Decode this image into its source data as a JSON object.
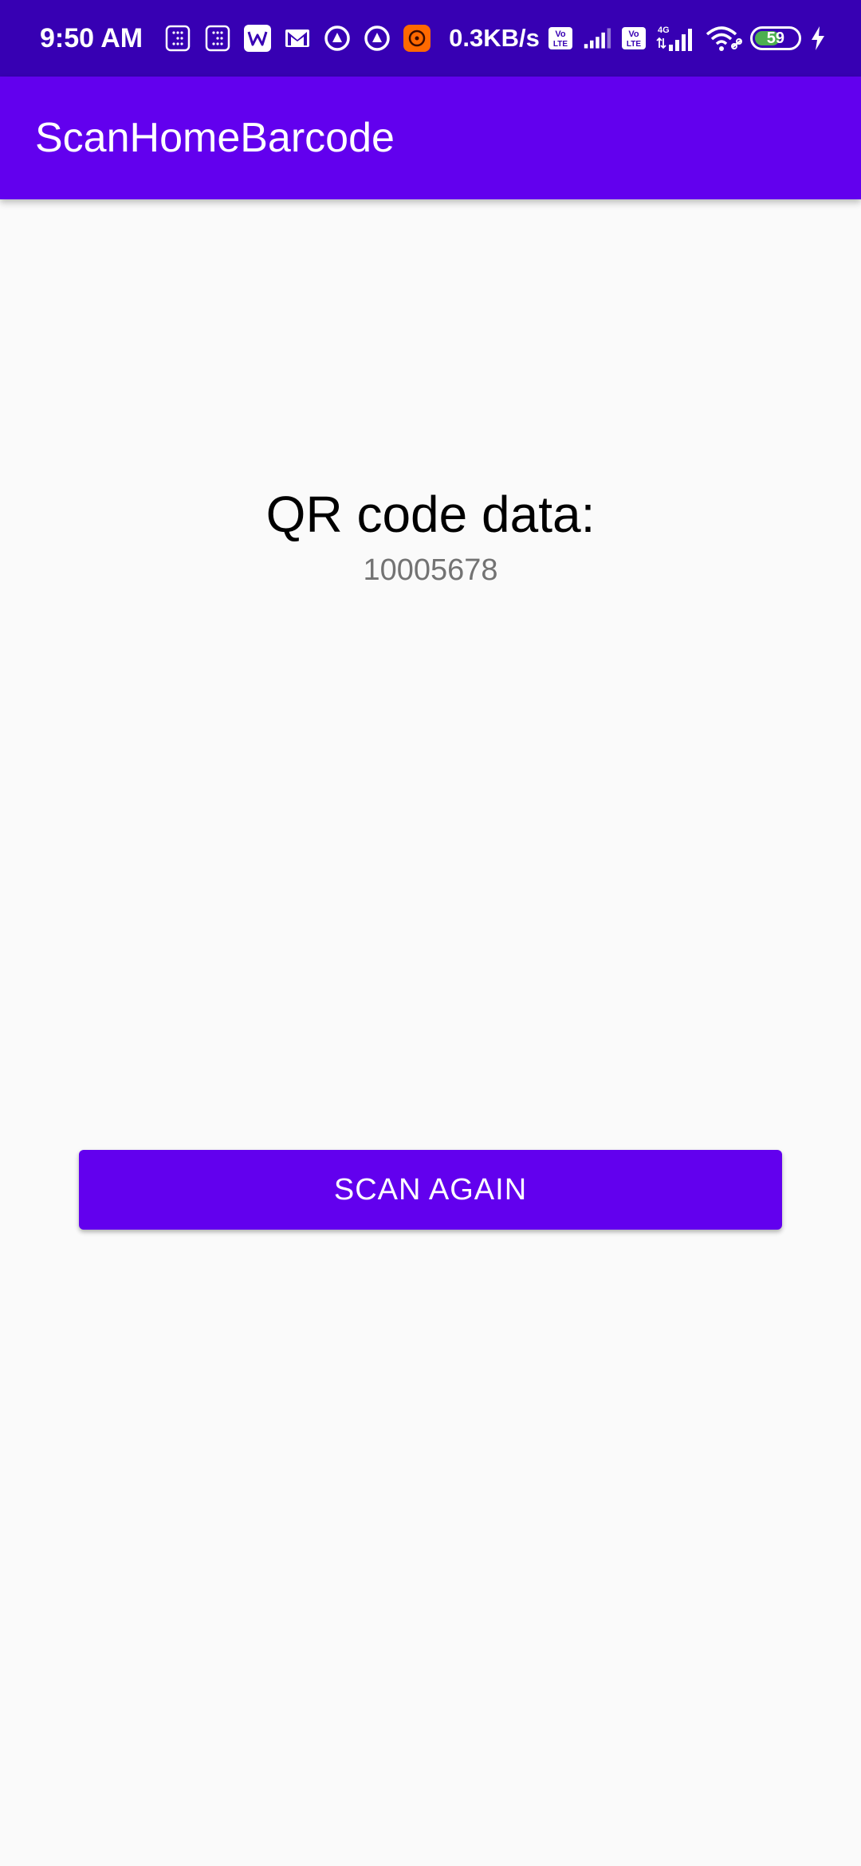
{
  "status_bar": {
    "time": "9:50 AM",
    "network_speed": "0.3KB/s",
    "battery_level": "59",
    "battery_percent": 59,
    "network_type": "4G",
    "left_icons": [
      "calculator-icon",
      "calculator-icon",
      "wps-office-icon",
      "gmail-icon",
      "app-icon",
      "app-icon",
      "mi-icon"
    ],
    "right_icons": [
      "volte-icon",
      "signal-icon",
      "volte-icon",
      "signal-4g-icon",
      "wifi-icon",
      "battery-icon",
      "charging-icon"
    ]
  },
  "app_bar": {
    "title": "ScanHomeBarcode"
  },
  "main": {
    "qr_label": "QR code data:",
    "qr_value": "10005678",
    "scan_button_label": "SCAN AGAIN"
  },
  "colors": {
    "status_bar": "#3700b3",
    "primary": "#6200ee",
    "background": "#fafafa",
    "value_text": "#737373",
    "battery_fill": "#4caf50",
    "mi_icon": "#ff6900"
  }
}
